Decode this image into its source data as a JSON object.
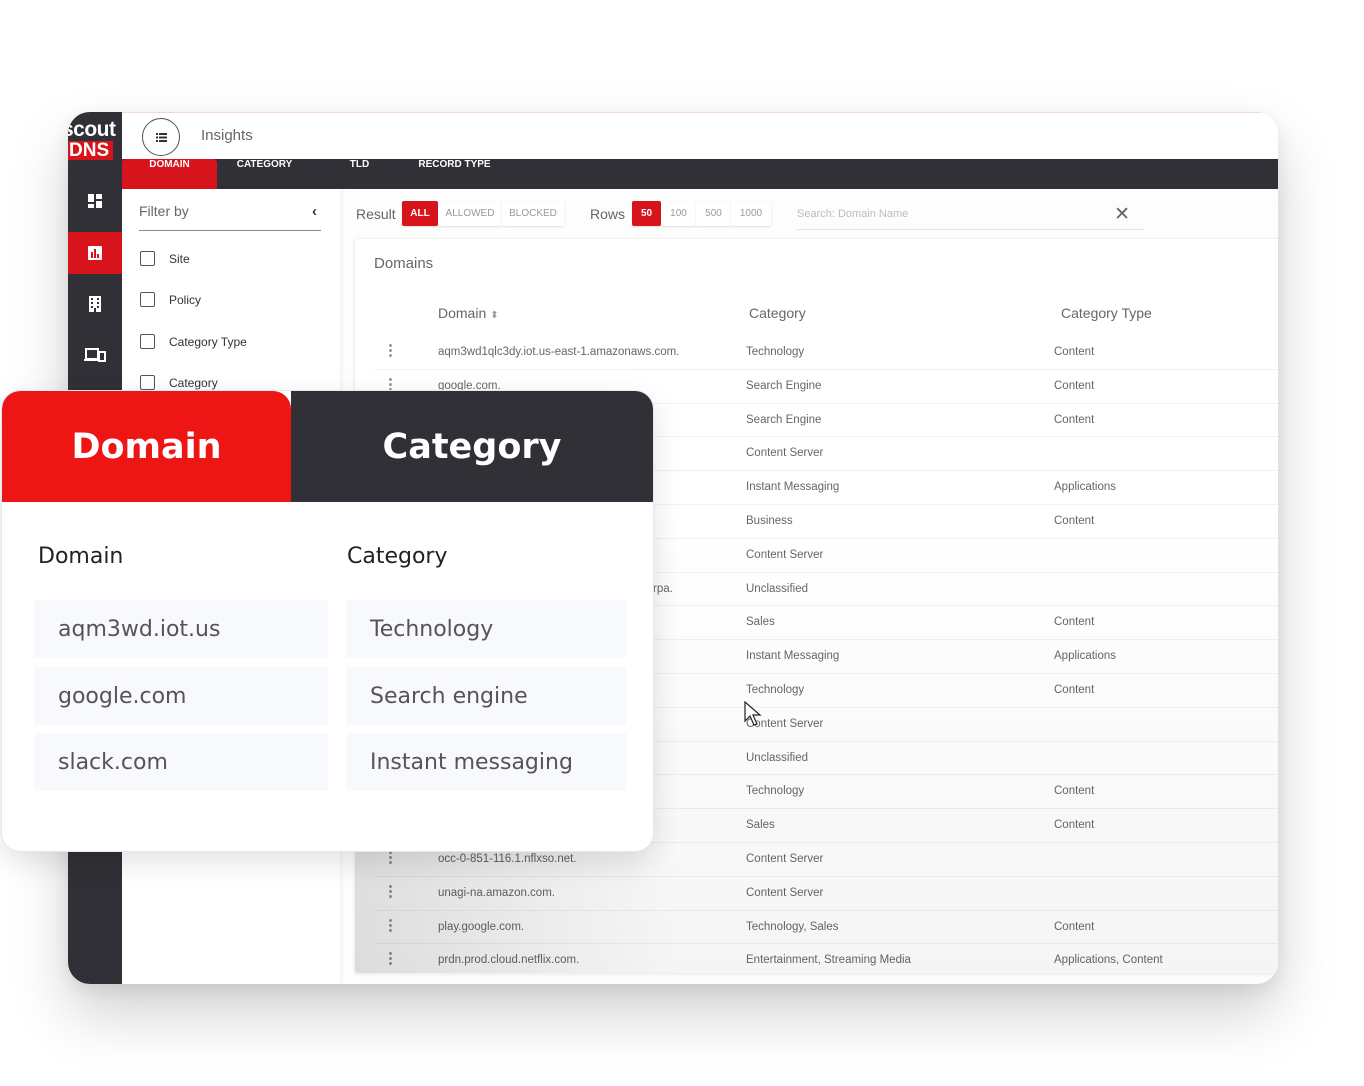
{
  "app": {
    "logo_top": "scout",
    "logo_bottom": "DNS",
    "page_title": "Insights",
    "rail_icons": [
      "dashboard-icon",
      "insights-chart-icon",
      "building-icon",
      "devices-icon"
    ],
    "accent_color": "#d7141b",
    "dark_color": "#303036"
  },
  "tabs": [
    {
      "label": "DOMAIN",
      "active": true
    },
    {
      "label": "CATEGORY",
      "active": false
    },
    {
      "label": "TLD",
      "active": false
    },
    {
      "label": "RECORD TYPE",
      "active": false
    }
  ],
  "filter": {
    "title": "Filter by",
    "items": [
      "Site",
      "Policy",
      "Category Type",
      "Category"
    ]
  },
  "toolbar": {
    "result_label": "Result",
    "result_options": [
      {
        "label": "ALL",
        "selected": true
      },
      {
        "label": "ALLOWED",
        "selected": false
      },
      {
        "label": "BLOCKED",
        "selected": false
      }
    ],
    "rows_label": "Rows",
    "rows_options": [
      {
        "label": "50",
        "selected": true
      },
      {
        "label": "100",
        "selected": false
      },
      {
        "label": "500",
        "selected": false
      },
      {
        "label": "1000",
        "selected": false
      }
    ],
    "search_placeholder": "Search: Domain Name",
    "search_value": ""
  },
  "table": {
    "title": "Domains",
    "columns": [
      "Domain",
      "Category",
      "Category Type"
    ],
    "rows": [
      {
        "domain": "aqm3wd1qlc3dy.iot.us-east-1.amazonaws.com.",
        "category": "Technology",
        "type": "Content"
      },
      {
        "domain": "google.com.",
        "category": "Search Engine",
        "type": "Content"
      },
      {
        "domain": "",
        "category": "Search Engine",
        "type": "Content"
      },
      {
        "domain": "",
        "category": "Content Server",
        "type": ""
      },
      {
        "domain": "",
        "category": "Instant Messaging",
        "type": "Applications"
      },
      {
        "domain": "",
        "category": "Business",
        "type": "Content"
      },
      {
        "domain": "",
        "category": "Content Server",
        "type": ""
      },
      {
        "domain": "rpa.",
        "category": "Unclassified",
        "type": ""
      },
      {
        "domain": "",
        "category": "Sales",
        "type": "Content"
      },
      {
        "domain": "",
        "category": "Instant Messaging",
        "type": "Applications"
      },
      {
        "domain": "",
        "category": "Technology",
        "type": "Content"
      },
      {
        "domain": "",
        "category": "Content Server",
        "type": ""
      },
      {
        "domain": "",
        "category": "Unclassified",
        "type": ""
      },
      {
        "domain": "",
        "category": "Technology",
        "type": "Content"
      },
      {
        "domain": "",
        "category": "Sales",
        "type": "Content"
      },
      {
        "domain": "occ-0-851-116.1.nflxso.net.",
        "category": "Content Server",
        "type": ""
      },
      {
        "domain": "unagi-na.amazon.com.",
        "category": "Content Server",
        "type": ""
      },
      {
        "domain": "play.google.com.",
        "category": "Technology, Sales",
        "type": "Content"
      },
      {
        "domain": "prdn.prod.cloud.netflix.com.",
        "category": "Entertainment, Streaming Media",
        "type": "Applications, Content"
      }
    ]
  },
  "overlay": {
    "tab_domain": "Domain",
    "tab_category": "Category",
    "head_domain": "Domain",
    "head_category": "Category",
    "rows": [
      {
        "domain": "aqm3wd.iot.us",
        "category": "Technology"
      },
      {
        "domain": "google.com",
        "category": "Search engine"
      },
      {
        "domain": "slack.com",
        "category": "Instant messaging"
      }
    ]
  }
}
